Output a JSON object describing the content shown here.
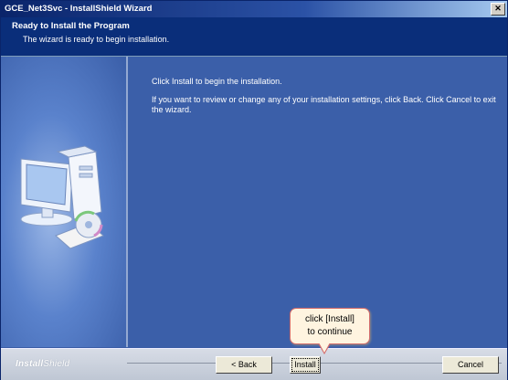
{
  "window": {
    "title": "GCE_Net3Svc - InstallShield Wizard",
    "close_glyph": "✕"
  },
  "header": {
    "title": "Ready to Install the Program",
    "subtitle": "The wizard is ready to begin installation."
  },
  "content": {
    "line1": "Click Install to begin the installation.",
    "line2": "If you want to review or change any of your installation settings, click Back. Click Cancel to exit the wizard."
  },
  "footer": {
    "brand_bold": "Install",
    "brand_light": "Shield",
    "back_label": "< Back",
    "install_label": "Install",
    "cancel_label": "Cancel"
  },
  "callout": {
    "line1": "click [Install]",
    "line2": "to continue"
  },
  "icons": {
    "illustration": "computer-and-disc-icon"
  }
}
